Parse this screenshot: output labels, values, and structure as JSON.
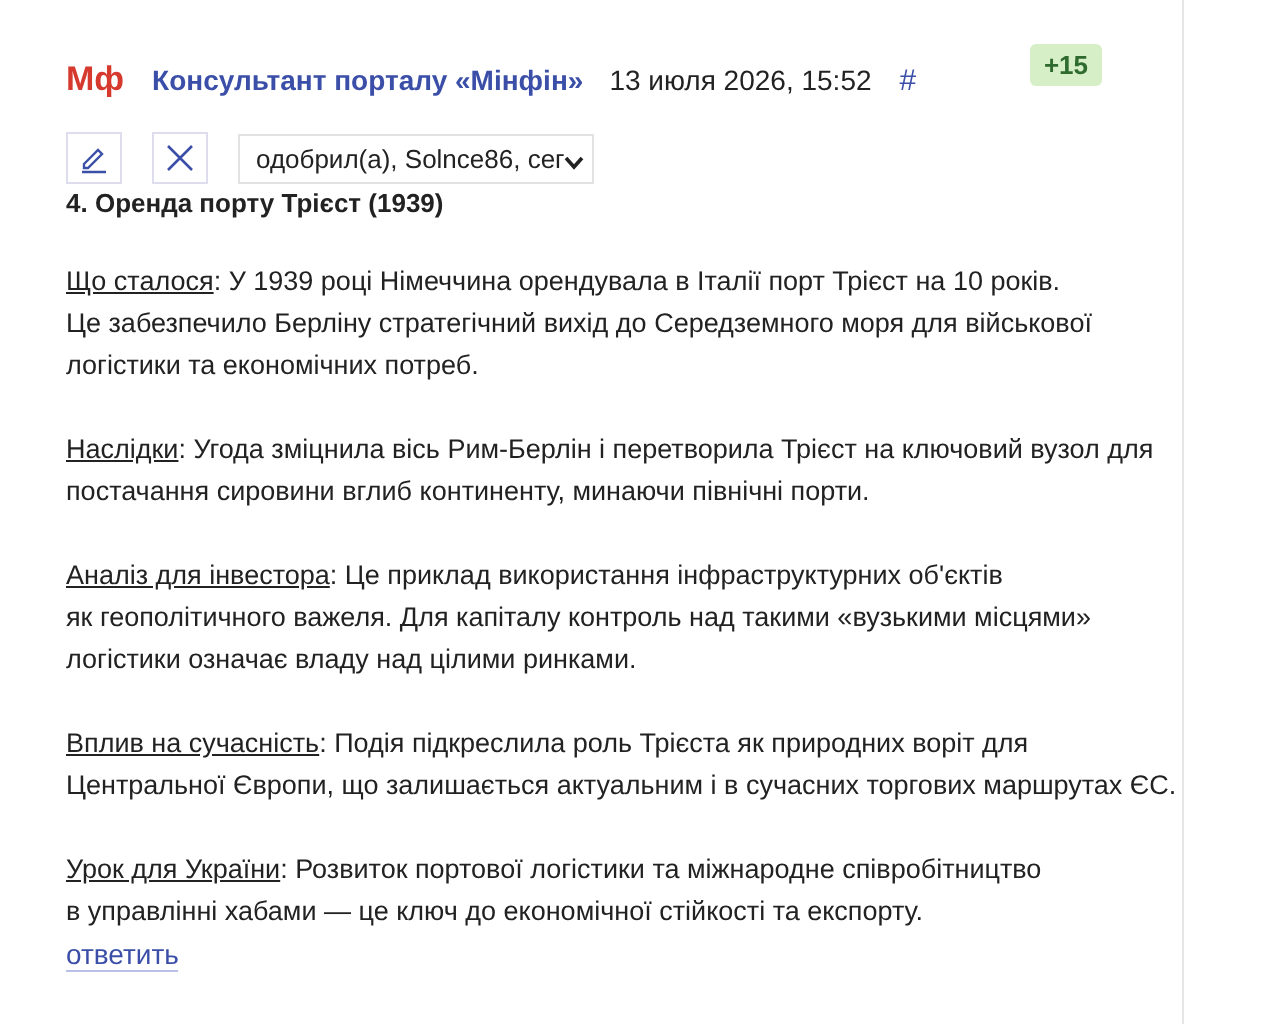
{
  "comment": {
    "avatar": "Мф",
    "author": "Консультант порталу «Мінфін»",
    "datetime": "13 июля 2026, 15:52",
    "anchor": "#",
    "rating": "+15"
  },
  "moderation": {
    "select_value": "одобрил(а), Solnce86, сег"
  },
  "heading": "4. Оренда порту Трієст (1939)",
  "paragraphs": [
    {
      "term": "Що сталося",
      "lines": [
        ": У 1939 році Німеччина орендувала в Італії порт Трієст на 10 років.",
        "Це забезпечило Берліну стратегічний вихід до Середземного моря для військової",
        "логістики та економічних потреб."
      ]
    },
    {
      "term": "Наслідки",
      "lines": [
        ": Угода зміцнила вісь Рим-Берлін і перетворила Трієст на ключовий вузол для",
        "постачання сировини вглиб континенту, минаючи північні порти."
      ]
    },
    {
      "term": "Аналіз для інвестора",
      "lines": [
        ": Це приклад використання інфраструктурних об'єктів",
        "як геополітичного важеля. Для капіталу контроль над такими «вузькими місцями»",
        "логістики означає владу над цілими ринками."
      ]
    },
    {
      "term": "Вплив на сучасність",
      "lines": [
        ": Подія підкреслила роль Трієста як природних воріт для",
        "Центральної Європи, що залишається актуальним і в сучасних торгових маршрутах ЄС."
      ]
    },
    {
      "term": "Урок для України",
      "lines": [
        ": Розвиток портової логістики та міжнародне співробітництво",
        "в управлінні хабами — це ключ до економічної стійкості та експорту."
      ]
    }
  ],
  "reply_link": "ответить"
}
